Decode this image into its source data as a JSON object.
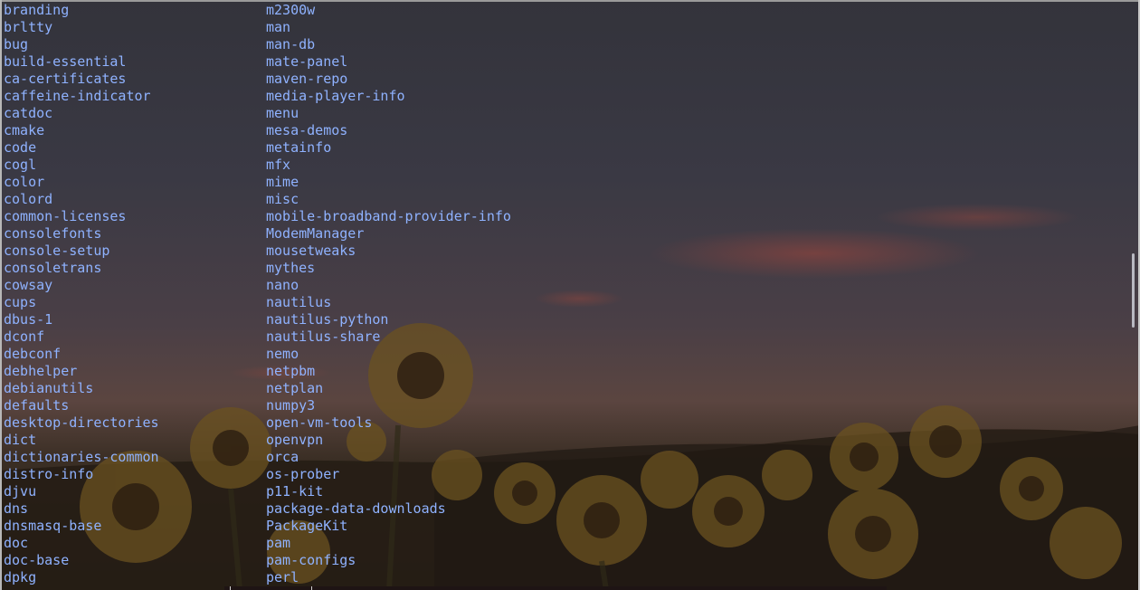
{
  "terminal": {
    "left_column": [
      "branding",
      "brltty",
      "bug",
      "build-essential",
      "ca-certificates",
      "caffeine-indicator",
      "catdoc",
      "cmake",
      "code",
      "cogl",
      "color",
      "colord",
      "common-licenses",
      "consolefonts",
      "console-setup",
      "consoletrans",
      "cowsay",
      "cups",
      "dbus-1",
      "dconf",
      "debconf",
      "debhelper",
      "debianutils",
      "defaults",
      "desktop-directories",
      "dict",
      "dictionaries-common",
      "distro-info",
      "djvu",
      "dns",
      "dnsmasq-base",
      "doc",
      "doc-base",
      "dpkg"
    ],
    "right_column": [
      "m2300w",
      "man",
      "man-db",
      "mate-panel",
      "maven-repo",
      "media-player-info",
      "menu",
      "mesa-demos",
      "metainfo",
      "mfx",
      "mime",
      "misc",
      "mobile-broadband-provider-info",
      "ModemManager",
      "mousetweaks",
      "mythes",
      "nano",
      "nautilus",
      "nautilus-python",
      "nautilus-share",
      "nemo",
      "netpbm",
      "netplan",
      "numpy3",
      "open-vm-tools",
      "openvpn",
      "orca",
      "os-prober",
      "p11-kit",
      "package-data-downloads",
      "PackageKit",
      "pam",
      "pam-configs",
      "perl"
    ],
    "text_color": "#8fb2ff",
    "background": "sunflower-field-at-dusk wallpaper"
  }
}
